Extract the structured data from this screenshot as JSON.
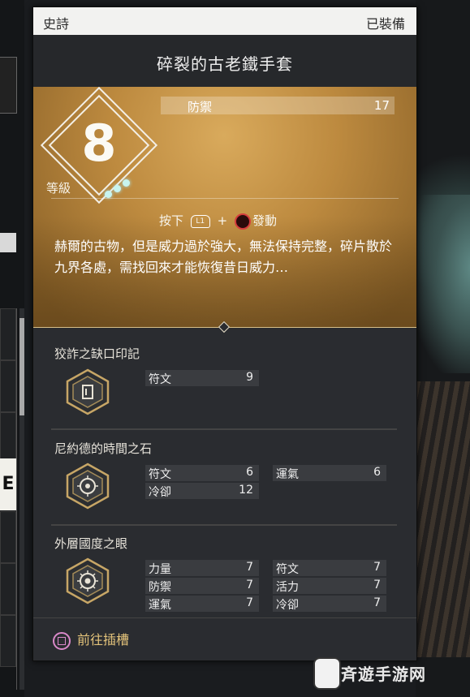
{
  "header": {
    "rarity": "史詩",
    "status": "已裝備"
  },
  "item": {
    "name": "碎裂的古老鐵手套",
    "level_label": "等級",
    "level": "8",
    "stat": {
      "label": "防禦",
      "value": "17"
    },
    "prompt": {
      "press": "按下",
      "button": "L1",
      "plus": "+",
      "action": "發動"
    },
    "description": "赫爾的古物，但是威力過於強大，無法保持完整，碎片散於九界各處，需找回來才能恢復昔日威力…"
  },
  "runes": [
    {
      "name": "狡詐之缺口印記",
      "attributes": [
        {
          "label": "符文",
          "value": "9"
        }
      ]
    },
    {
      "name": "尼約德的時間之石",
      "attributes": [
        {
          "label": "符文",
          "value": "6"
        },
        {
          "label": "運氣",
          "value": "6"
        },
        {
          "label": "冷卻",
          "value": "12"
        }
      ]
    },
    {
      "name": "外層國度之眼",
      "attributes": [
        {
          "label": "力量",
          "value": "7"
        },
        {
          "label": "符文",
          "value": "7"
        },
        {
          "label": "防禦",
          "value": "7"
        },
        {
          "label": "活力",
          "value": "7"
        },
        {
          "label": "運氣",
          "value": "7"
        },
        {
          "label": "冷卻",
          "value": "7"
        }
      ]
    }
  ],
  "action": {
    "label": "前往插槽"
  },
  "left_panel": {
    "letter": "E"
  },
  "watermark": {
    "text": "斉遊手游网"
  },
  "colors": {
    "accent_gold": "#c79748",
    "slot_text": "#e2c27a",
    "level_dots": "#c8f4f0",
    "circle_button": "#d43c3c"
  }
}
